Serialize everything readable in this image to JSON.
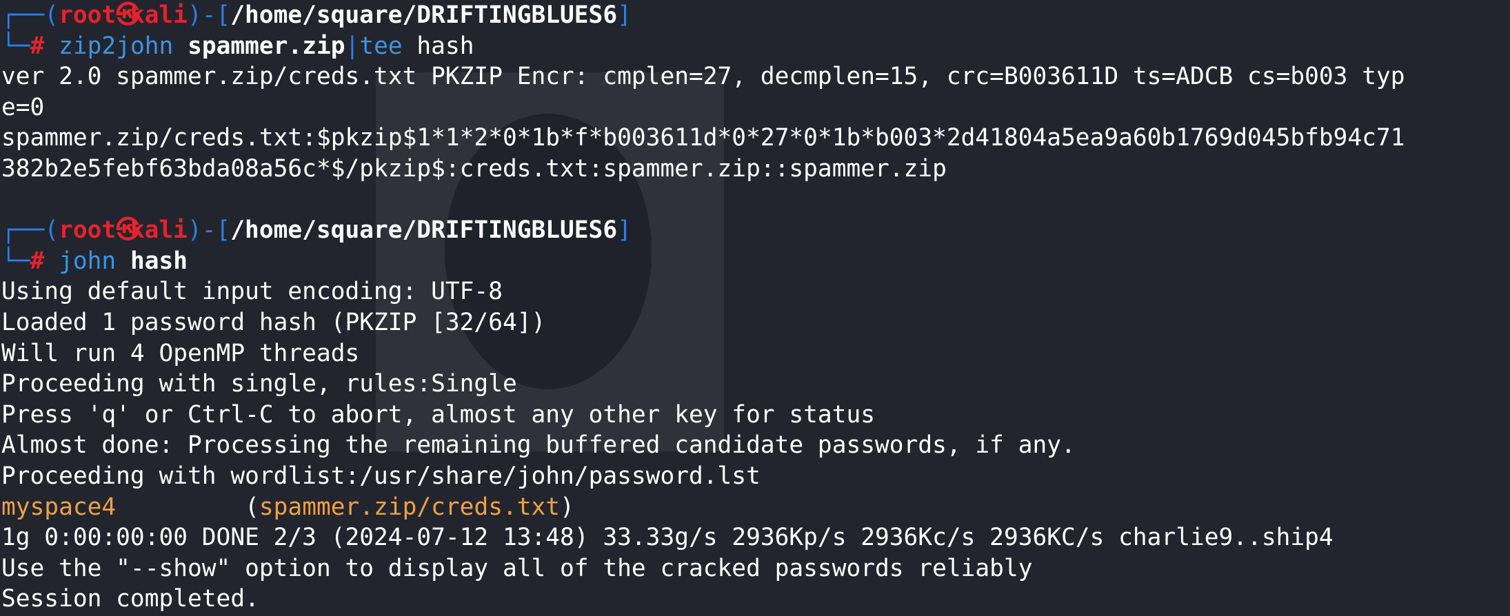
{
  "prompt": {
    "corner_top": "┌──",
    "corner_bottom": "└─",
    "open_paren": "(",
    "user": "root",
    "host": "kali",
    "close_paren_dash_bracket": ")-[",
    "path": "/home/square/DRIFTINGBLUES6",
    "close_bracket": "]",
    "hash_symbol": "#",
    "kali_icon": "㉿"
  },
  "blocks": [
    {
      "command": "zip2john",
      "args_bold": "spammer.zip",
      "pipe": "|",
      "pipe_cmd": "tee",
      "pipe_args": " hash",
      "output": [
        "ver 2.0 spammer.zip/creds.txt PKZIP Encr: cmplen=27, decmplen=15, crc=B003611D ts=ADCB cs=b003 typ",
        "e=0",
        "spammer.zip/creds.txt:$pkzip$1*1*2*0*1b*f*b003611d*0*27*0*1b*b003*2d41804a5ea9a60b1769d045bfb94c71",
        "382b2e5febf63bda08a56c*$/pkzip$:creds.txt:spammer.zip::spammer.zip",
        ""
      ]
    },
    {
      "command": "john",
      "args_bold": "hash",
      "output": [
        "Using default input encoding: UTF-8",
        "Loaded 1 password hash (PKZIP [32/64])",
        "Will run 4 OpenMP threads",
        "Proceeding with single, rules:Single",
        "Press 'q' or Ctrl-C to abort, almost any other key for status",
        "Almost done: Processing the remaining buffered candidate passwords, if any.",
        "Proceeding with wordlist:/usr/share/john/password.lst"
      ],
      "cracked": {
        "password": "myspace4",
        "spacing": "         ",
        "open_paren": "(",
        "target": "spammer.zip/creds.txt",
        "close_paren": ")"
      },
      "output_after": [
        "1g 0:00:00:00 DONE 2/3 (2024-07-12 13:48) 33.33g/s 2936Kp/s 2936Kc/s 2936KC/s charlie9..ship4",
        "Use the \"--show\" option to display all of the cracked passwords reliably",
        "Session completed."
      ]
    }
  ],
  "colors": {
    "background": "#22252e",
    "prompt_blue": "#2f7de0",
    "prompt_red": "#e6222d",
    "cracked_orange": "#f0a043",
    "text": "#ffffff"
  }
}
